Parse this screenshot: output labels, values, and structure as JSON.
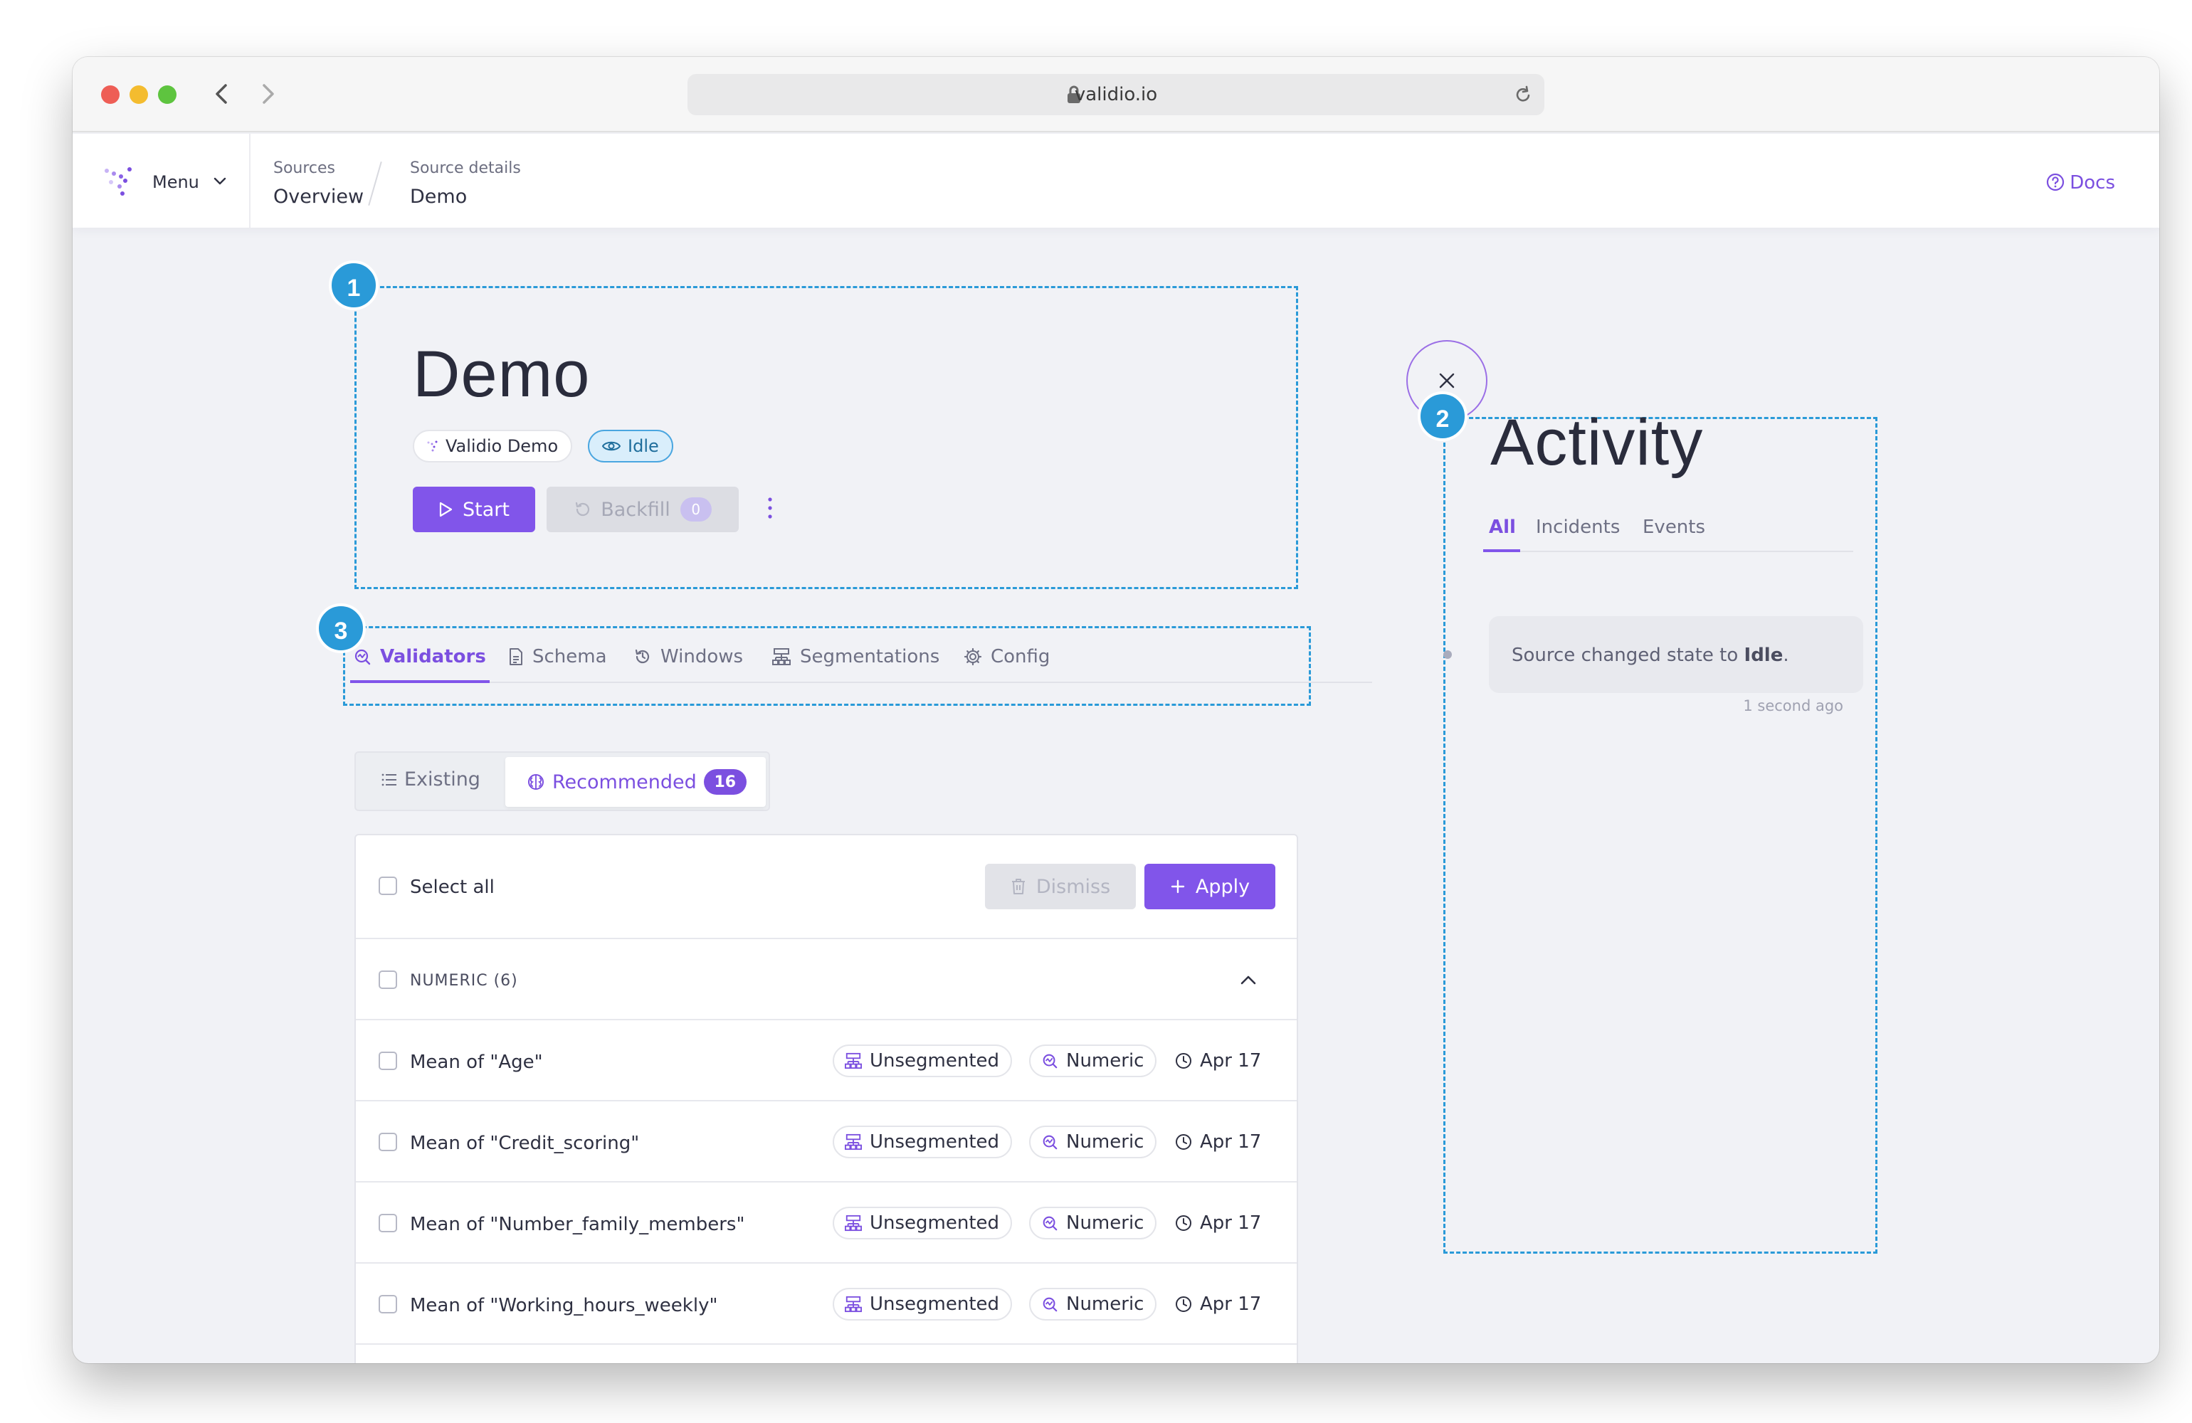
{
  "browser": {
    "url": "validio.io"
  },
  "header": {
    "menu_label": "Menu",
    "breadcrumbs": [
      {
        "label": "Sources",
        "value": "Overview"
      },
      {
        "label": "Source details",
        "value": "Demo"
      }
    ],
    "docs_label": "Docs"
  },
  "annotations": [
    "1",
    "2",
    "3"
  ],
  "source": {
    "title": "Demo",
    "source_name": "Validio Demo",
    "status": "Idle",
    "start_label": "Start",
    "backfill_label": "Backfill",
    "backfill_count": "0"
  },
  "tabs": [
    {
      "label": "Validators",
      "icon": "validator-icon",
      "active": true
    },
    {
      "label": "Schema",
      "icon": "document-icon"
    },
    {
      "label": "Windows",
      "icon": "history-icon"
    },
    {
      "label": "Segmentations",
      "icon": "hierarchy-icon"
    },
    {
      "label": "Config",
      "icon": "gear-icon"
    }
  ],
  "view_toggle": {
    "existing_label": "Existing",
    "recommended_label": "Recommended",
    "recommended_count": "16"
  },
  "validators": {
    "select_all_label": "Select all",
    "dismiss_label": "Dismiss",
    "apply_label": "Apply",
    "group_label": "NUMERIC (6)",
    "rows": [
      {
        "name": "Mean of \"Age\"",
        "segmentation": "Unsegmented",
        "type": "Numeric",
        "date": "Apr 17"
      },
      {
        "name": "Mean of \"Credit_scoring\"",
        "segmentation": "Unsegmented",
        "type": "Numeric",
        "date": "Apr 17"
      },
      {
        "name": "Mean of \"Number_family_members\"",
        "segmentation": "Unsegmented",
        "type": "Numeric",
        "date": "Apr 17"
      },
      {
        "name": "Mean of \"Working_hours_weekly\"",
        "segmentation": "Unsegmented",
        "type": "Numeric",
        "date": "Apr 17"
      }
    ]
  },
  "activity": {
    "title": "Activity",
    "tabs": [
      "All",
      "Incidents",
      "Events"
    ],
    "event_prefix": "Source changed state to ",
    "event_state": "Idle",
    "event_suffix": ".",
    "event_time": "1 second ago"
  },
  "colors": {
    "accent": "#8155ea",
    "annotation": "#2a9ad8",
    "status_bg": "#d9eefb"
  }
}
